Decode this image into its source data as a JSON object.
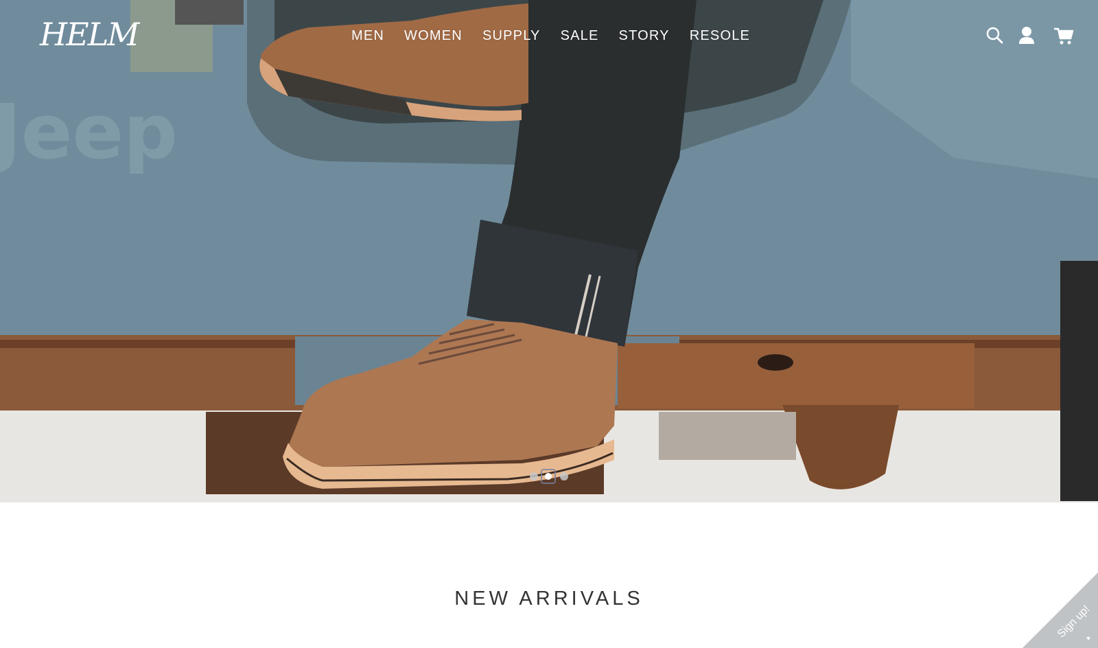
{
  "brand": {
    "logo_text": "HELM"
  },
  "nav": {
    "items": [
      {
        "label": "MEN"
      },
      {
        "label": "WOMEN"
      },
      {
        "label": "SUPPLY"
      },
      {
        "label": "SALE"
      },
      {
        "label": "STORY"
      },
      {
        "label": "RESOLE"
      }
    ]
  },
  "header_icons": [
    "search-icon",
    "account-icon",
    "cart-icon"
  ],
  "hero": {
    "carousel": {
      "slides": 3,
      "active_slide": 2
    },
    "colors": {
      "jeep_body": "#6e8898",
      "boot_leather": "#b57d55",
      "rust": "#8a4f2a"
    }
  },
  "sections": {
    "new_arrivals_title": "NEW ARRIVALS"
  },
  "signup": {
    "label": "Sign up!",
    "color": "#bfc3c6"
  }
}
